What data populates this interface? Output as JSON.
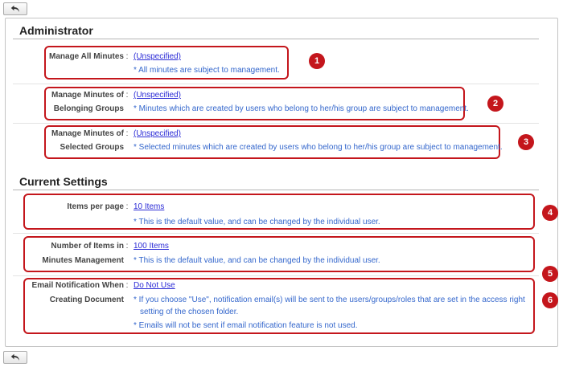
{
  "nav": {
    "back_icon": "back-arrow-icon"
  },
  "administrator": {
    "title": "Administrator",
    "rows": [
      {
        "label": "Manage All Minutes",
        "value": "(Unspecified)",
        "notes": [
          "* All minutes are subject to management."
        ],
        "badge": "1"
      },
      {
        "label_lines": [
          "Manage Minutes of",
          "Belonging Groups"
        ],
        "value": "(Unspecified)",
        "notes": [
          "* Minutes which are created by users who belong to her/his group are subject to management."
        ],
        "badge": "2"
      },
      {
        "label_lines": [
          "Manage Minutes of",
          "Selected Groups"
        ],
        "value": "(Unspecified)",
        "notes": [
          "* Selected minutes which are created by users who belong to her/his group are subject to management."
        ],
        "badge": "3"
      }
    ]
  },
  "current_settings": {
    "title": "Current Settings",
    "rows": [
      {
        "label": "Items per page",
        "value": "10 Items",
        "notes": [
          "* This is the default value, and can be changed by the individual user."
        ],
        "badge": "4"
      },
      {
        "label_lines": [
          "Number of Items in",
          "Minutes Management"
        ],
        "value": "100 Items",
        "notes": [
          "* This is the default value, and can be changed by the individual user."
        ],
        "badge": "5"
      },
      {
        "label_lines": [
          "Email Notification When",
          "Creating Document"
        ],
        "value": "Do Not Use",
        "notes": [
          "* If you choose \"Use\", notification email(s) will be sent to the users/groups/roles that are set in the access right",
          "setting of the chosen folder.",
          "* Emails will not be sent if email notification feature is not used."
        ],
        "badge": "6"
      }
    ]
  },
  "colon": ":"
}
